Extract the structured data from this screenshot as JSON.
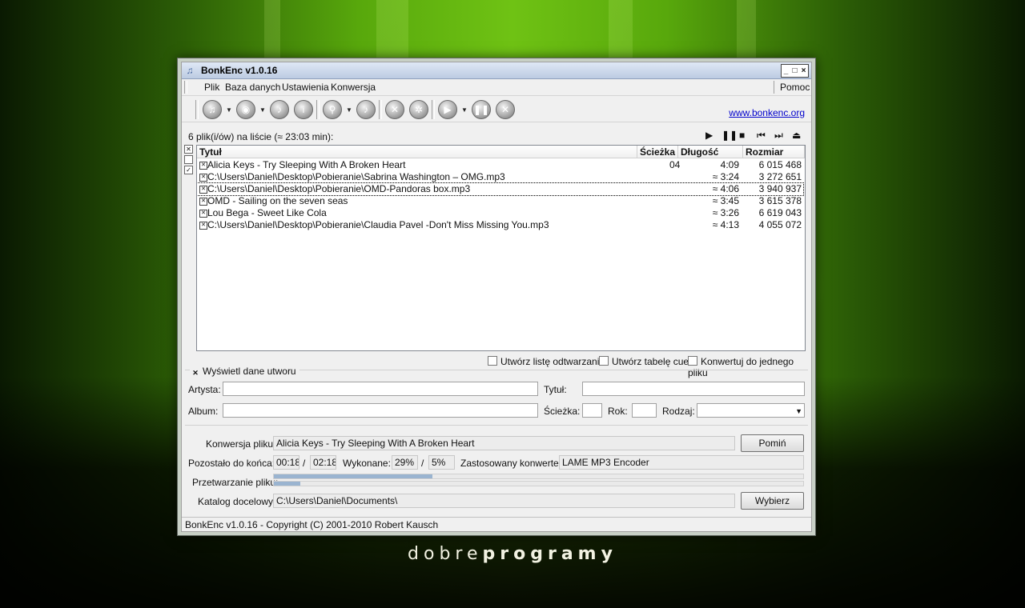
{
  "window": {
    "title": "BonkEnc v1.0.16",
    "min": "_",
    "max": "□",
    "close": "×"
  },
  "menu": {
    "file": "Plik",
    "database": "Baza danych",
    "settings": "Ustawienia",
    "convert": "Konwersja",
    "help": "Pomoc"
  },
  "toolbar": {
    "icons": [
      "add-file-icon",
      "add-cd-icon",
      "music-note-icon",
      "file-info-icon",
      "search-icon",
      "cddb-icon",
      "tools-icon",
      "settings-gear-icon",
      "play-convert-icon",
      "pause-icon",
      "stop-icon"
    ],
    "link": "www.bonkenc.org"
  },
  "playlist": {
    "count_text": "6 plik(i/ów) na liście (≈ 23:03 min):",
    "columns": {
      "title": "Tytuł",
      "track": "Ścieżka",
      "length": "Długość",
      "size": "Rozmiar"
    },
    "rows": [
      {
        "title": "Alicia Keys - Try Sleeping With A Broken Heart",
        "track": "04",
        "length": "4:09",
        "size": "6 015 468"
      },
      {
        "title": "C:\\Users\\Daniel\\Desktop\\Pobieranie\\Sabrina Washington – OMG.mp3",
        "track": "",
        "length": "≈ 3:24",
        "size": "3 272 651"
      },
      {
        "title": "C:\\Users\\Daniel\\Desktop\\Pobieranie\\OMD-Pandoras box.mp3",
        "track": "",
        "length": "≈ 4:06",
        "size": "3 940 937"
      },
      {
        "title": "OMD - Sailing on the seven seas",
        "track": "",
        "length": "≈ 3:45",
        "size": "3 615 378"
      },
      {
        "title": "Lou Bega - Sweet Like Cola",
        "track": "",
        "length": "≈ 3:26",
        "size": "6 619 043"
      },
      {
        "title": "C:\\Users\\Daniel\\Desktop\\Pobieranie\\Claudia Pavel -Don't Miss Missing You.mp3",
        "track": "",
        "length": "≈ 4:13",
        "size": "4 055 072"
      }
    ]
  },
  "options": {
    "playlist": "Utwórz listę odtwarzania",
    "cue": "Utwórz tabelę cue",
    "single": "Konwertuj do jednego pliku"
  },
  "track_info": {
    "toggle": "Wyświetl dane utworu",
    "artist_label": "Artysta:",
    "title_label": "Tytuł:",
    "album_label": "Album:",
    "track_label": "Ścieżka:",
    "year_label": "Rok:",
    "genre_label": "Rodzaj:"
  },
  "conversion": {
    "file_label": "Konwersja pliku:",
    "file_value": "Alicia Keys - Try Sleeping With A Broken Heart",
    "skip": "Pomiń",
    "remaining_label": "Pozostało do końca:",
    "remaining": "00:18",
    "total": "02:18",
    "slash": "/",
    "done_label": "Wykonane:",
    "done_file": "29%",
    "done_total": "5%",
    "encoder_label": "Zastosowany konwerter:",
    "encoder": "LAME MP3 Encoder",
    "processing_label": "Przetwarzanie pliku:",
    "file_progress": 0.3,
    "total_progress": 0.05,
    "output_label": "Katalog docelowy:",
    "output_dir": "C:\\Users\\Daniel\\Documents\\",
    "choose": "Wybierz"
  },
  "statusbar": "BonkEnc v1.0.16 - Copyright (C) 2001-2010 Robert Kausch",
  "brand": {
    "light": "dobre",
    "bold": "programy"
  }
}
